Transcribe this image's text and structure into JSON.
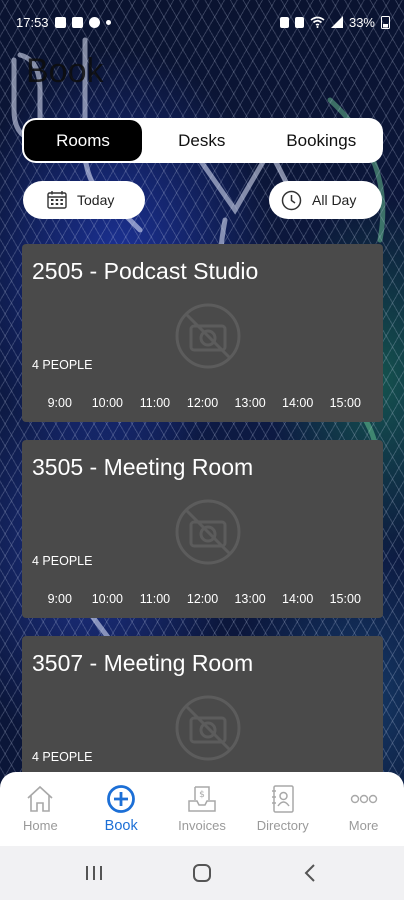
{
  "status_bar": {
    "time": "17:53",
    "battery": "33%"
  },
  "page": {
    "title": "Book"
  },
  "tabs": [
    {
      "label": "Rooms",
      "active": true
    },
    {
      "label": "Desks",
      "active": false
    },
    {
      "label": "Bookings",
      "active": false
    }
  ],
  "filters": {
    "date_label": "Today",
    "time_label": "All Day"
  },
  "rooms": [
    {
      "title": "2505 - Podcast Studio",
      "capacity": "4 PEOPLE",
      "times": [
        "9:00",
        "10:00",
        "11:00",
        "12:00",
        "13:00",
        "14:00",
        "15:00"
      ]
    },
    {
      "title": "3505 - Meeting Room",
      "capacity": "4 PEOPLE",
      "times": [
        "9:00",
        "10:00",
        "11:00",
        "12:00",
        "13:00",
        "14:00",
        "15:00"
      ]
    },
    {
      "title": "3507 - Meeting Room",
      "capacity": "4 PEOPLE",
      "times": []
    }
  ],
  "bottom_nav": [
    {
      "label": "Home",
      "icon": "home-icon",
      "active": false
    },
    {
      "label": "Book",
      "icon": "add-circle-icon",
      "active": true
    },
    {
      "label": "Invoices",
      "icon": "invoice-icon",
      "active": false
    },
    {
      "label": "Directory",
      "icon": "contact-book-icon",
      "active": false
    },
    {
      "label": "More",
      "icon": "more-icon",
      "active": false
    }
  ],
  "colors": {
    "accent": "#1c6fd6",
    "card": "#4a4a4a",
    "tab_active": "#000000"
  }
}
